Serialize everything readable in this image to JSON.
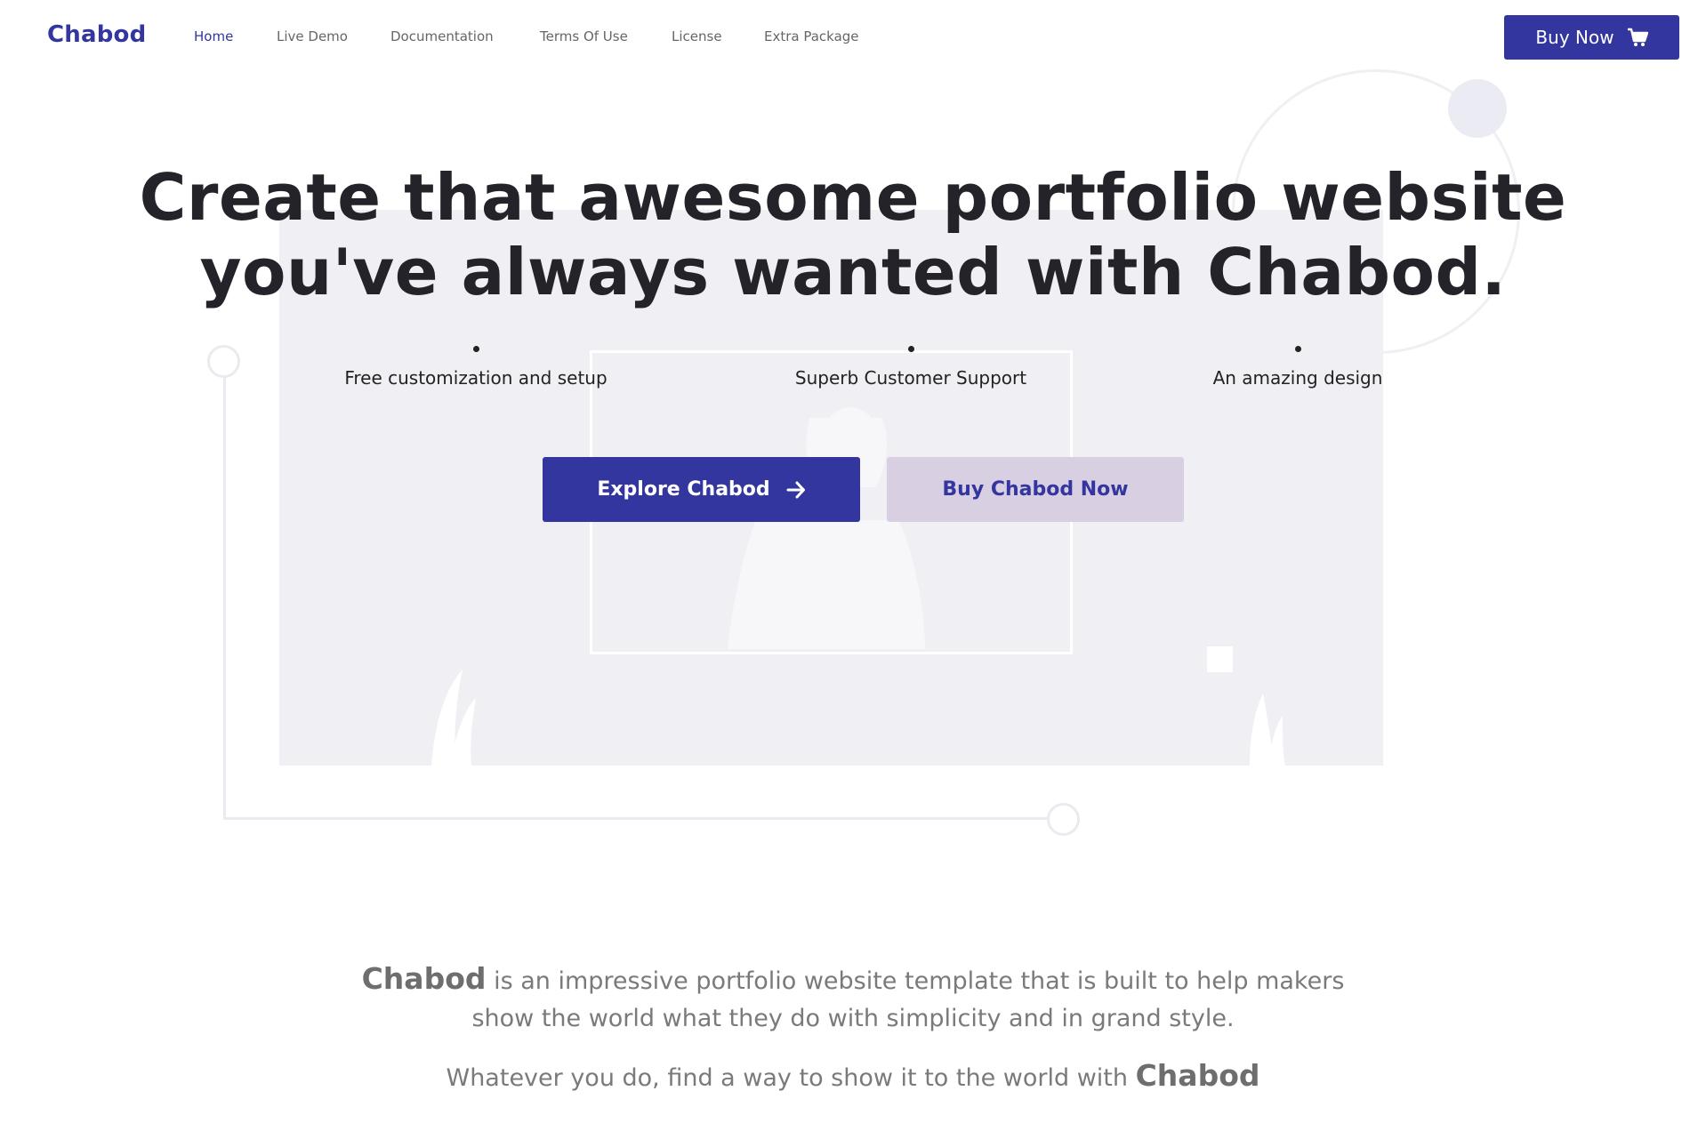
{
  "header": {
    "brand": "Chabod",
    "nav": [
      "Home",
      "Live Demo",
      "Documentation",
      "Terms Of Use",
      "License",
      "Extra Package"
    ],
    "buy_button": "Buy Now",
    "buy_icon": "cart-icon"
  },
  "hero": {
    "title_line1": "Create that awesome portfolio website",
    "title_line2": "you've always wanted with Chabod.",
    "features": [
      "Free customization and setup",
      "Superb Customer Support",
      "An amazing design"
    ],
    "explore_button": "Explore Chabod",
    "explore_icon": "arrow-right-icon",
    "buy_button": "Buy Chabod Now"
  },
  "about": {
    "brand": "Chabod",
    "line1_rest": " is an impressive portfolio website template that is built to help makers",
    "line2": "show the world what they do with simplicity and in grand style.",
    "line3_start": "Whatever you do, find a way to show it to the world with ",
    "line3_brand": "Chabod"
  },
  "colors": {
    "primary": "#33369e",
    "secondary": "#d8cfe2",
    "panel": "#f0f0f4"
  }
}
